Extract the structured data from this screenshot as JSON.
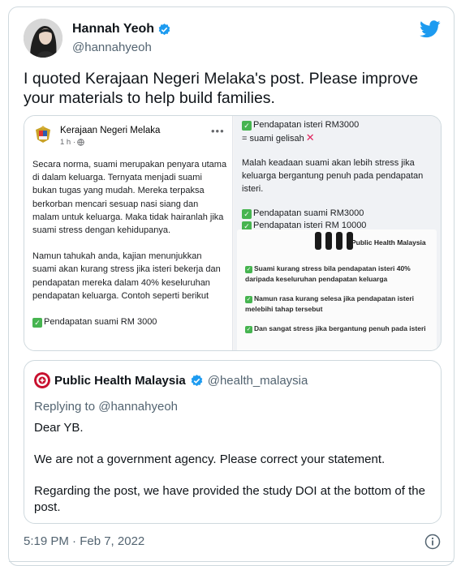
{
  "tweet": {
    "author_name": "Hannah Yeoh",
    "author_handle": "@hannahyeoh",
    "text": "I quoted Kerajaan Negeri Melaka's post. Please improve your materials to help build families.",
    "timestamp": "5:19 PM · Feb 7, 2022"
  },
  "media": {
    "fb_page_name": "Kerajaan Negeri Melaka",
    "fb_meta": "1 h ·",
    "fb_paragraph_1": "Secara norma, suami merupakan penyara utama di dalam keluarga. Ternyata menjadi suami bukan tugas yang mudah. Mereka terpaksa berkorban mencari sesuap nasi siang dan malam untuk keluarga. Maka tidak hairanlah jika suami stress dengan kehidupanya.",
    "fb_paragraph_2": "Namun tahukah anda, kajian menunjukkan suami akan kurang stress jika isteri bekerja dan pendapatan mereka dalam 40% keseluruhan pendapatan keluarga. Contoh seperti berikut",
    "fb_line_income_husband": "Pendapatan suami RM 3000",
    "right_top_line_1": "Pendapatan isteri RM3000",
    "right_top_line_2": "= suami gelisah",
    "right_paragraph": "Malah keadaan suami akan lebih stress jika keluarga bergantung penuh pada pendapatan isteri.",
    "right_check_1": "Pendapatan suami RM3000",
    "right_check_2": "Pendapatan isteri RM 10000",
    "slide_title": "Public Health Malaysia",
    "slide_item_1": "Suami kurang stress bila pendapatan isteri 40% daripada keseluruhan pendapatan keluarga",
    "slide_item_2": "Namun rasa kurang selesa jika pendapatan isteri melebihi tahap tersebut",
    "slide_item_3": "Dan sangat stress jika bergantung penuh pada isteri"
  },
  "quoted": {
    "author_name": "Public Health Malaysia",
    "author_handle": "@health_malaysia",
    "replying_to": "Replying to @hannahyeoh",
    "body": [
      "Dear YB.",
      "We are not a government agency. Please correct your statement.",
      "Regarding the post, we have provided the study DOI at the bottom of the post."
    ]
  },
  "icons": {
    "verified": "verified-badge-icon",
    "twitter": "twitter-bird-icon",
    "info": "info-icon",
    "globe": "globe-icon",
    "more": "more-dots-icon"
  },
  "colors": {
    "twitter_blue": "#1d9bf0",
    "text_primary": "#0f1419",
    "text_secondary": "#536471",
    "border": "#cfd9de",
    "check_green": "#46b450",
    "cross_red": "#e0245e"
  }
}
